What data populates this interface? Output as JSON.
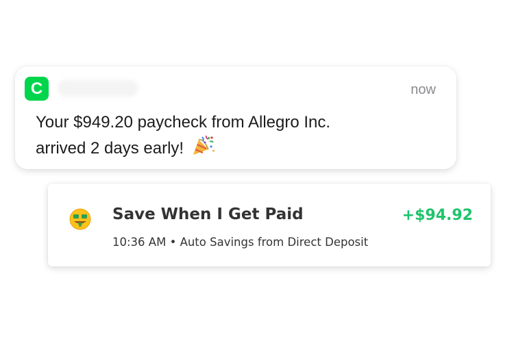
{
  "notification": {
    "app_icon_letter": "C",
    "time": "now",
    "message_line1": "Your $949.20 paycheck from Allegro Inc.",
    "message_line2": "arrived 2 days early!",
    "emoji_icon": "party-popper-icon"
  },
  "activity": {
    "emoji_icon": "money-mouth-face-icon",
    "title": "Save When I Get Paid",
    "time": "10:36 AM",
    "separator": " • ",
    "description": "Auto Savings from Direct Deposit",
    "amount": "+$94.92",
    "amount_color": "#1ec46c"
  },
  "colors": {
    "brand_green": "#00d54b",
    "text_dark": "#1c1c1e",
    "text_gray": "#8a8a8e"
  }
}
